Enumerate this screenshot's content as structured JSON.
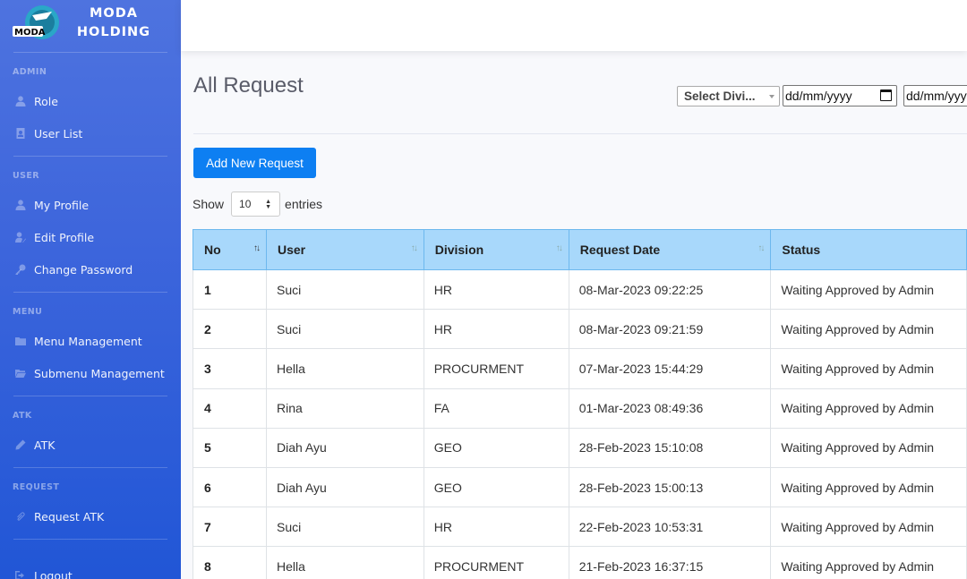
{
  "brand": {
    "logo_text": "MODA",
    "line1": "MODA",
    "line2": "HOLDING"
  },
  "sidebar": {
    "sections": [
      {
        "heading": "ADMIN",
        "items": [
          {
            "label": "Role",
            "icon": "user-icon"
          },
          {
            "label": "User List",
            "icon": "id-card-icon"
          }
        ]
      },
      {
        "heading": "USER",
        "items": [
          {
            "label": "My Profile",
            "icon": "user-icon"
          },
          {
            "label": "Edit Profile",
            "icon": "user-edit-icon"
          },
          {
            "label": "Change Password",
            "icon": "key-icon"
          }
        ]
      },
      {
        "heading": "MENU",
        "items": [
          {
            "label": "Menu Management",
            "icon": "folder-icon"
          },
          {
            "label": "Submenu Management",
            "icon": "folder-open-icon"
          }
        ]
      },
      {
        "heading": "ATK",
        "items": [
          {
            "label": "ATK",
            "icon": "pen-icon"
          }
        ]
      },
      {
        "heading": "REQUEST",
        "items": [
          {
            "label": "Request ATK",
            "icon": "paperclip-icon"
          }
        ]
      }
    ],
    "logout": "Logout"
  },
  "page": {
    "title": "All Request",
    "filter_division": "Select Divi...",
    "date_from_placeholder": "dd/mm/yyyy",
    "date_to_placeholder": "dd/mm/yyyy",
    "add_button": "Add New Request",
    "show_label": "Show",
    "entries_value": "10",
    "entries_label": "entries"
  },
  "table": {
    "columns": [
      "No",
      "User",
      "Division",
      "Request Date",
      "Status"
    ],
    "rows": [
      [
        "1",
        "Suci",
        "HR",
        "08-Mar-2023 09:22:25",
        "Waiting Approved by Admin"
      ],
      [
        "2",
        "Suci",
        "HR",
        "08-Mar-2023 09:21:59",
        "Waiting Approved by Admin"
      ],
      [
        "3",
        "Hella",
        "PROCURMENT",
        "07-Mar-2023 15:44:29",
        "Waiting Approved by Admin"
      ],
      [
        "4",
        "Rina",
        "FA",
        "01-Mar-2023 08:49:36",
        "Waiting Approved by Admin"
      ],
      [
        "5",
        "Diah Ayu",
        "GEO",
        "28-Feb-2023 15:10:08",
        "Waiting Approved by Admin"
      ],
      [
        "6",
        "Diah Ayu",
        "GEO",
        "28-Feb-2023 15:00:13",
        "Waiting Approved by Admin"
      ],
      [
        "7",
        "Suci",
        "HR",
        "22-Feb-2023 10:53:31",
        "Waiting Approved by Admin"
      ],
      [
        "8",
        "Hella",
        "PROCURMENT",
        "21-Feb-2023 16:37:15",
        "Waiting Approved by Admin"
      ]
    ]
  },
  "colors": {
    "sidebar": "#4e73df",
    "header_row": "#a8d8fb",
    "primary_button": "#0d7ff2"
  }
}
